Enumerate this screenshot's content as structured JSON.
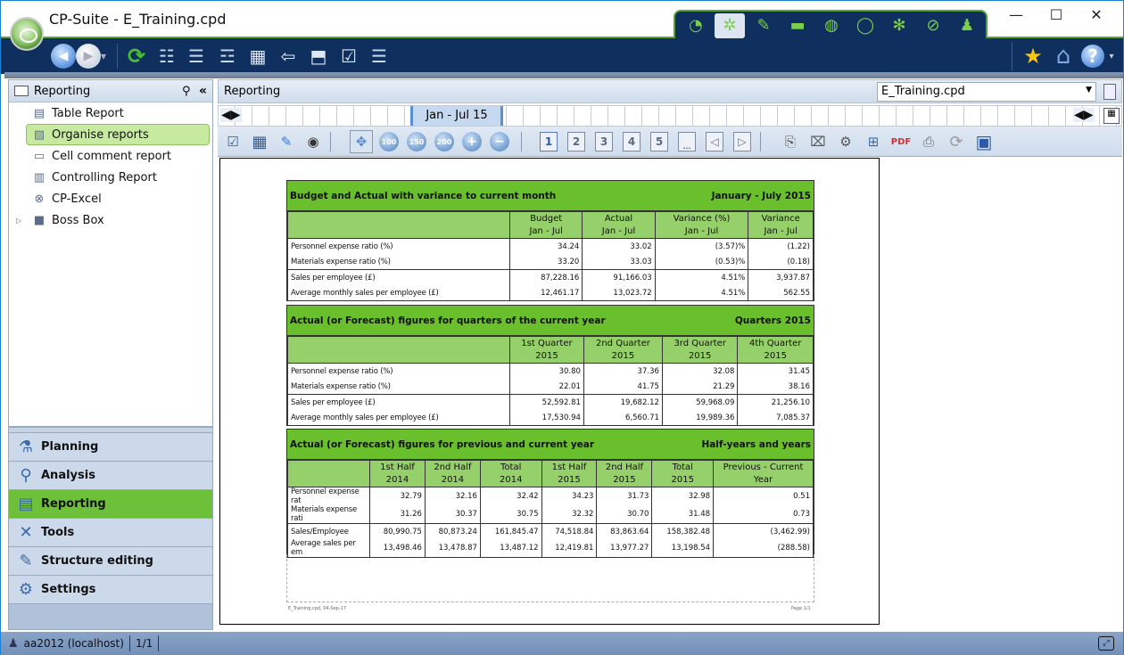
{
  "window": {
    "title": "CP-Suite - E_Training.cpd",
    "controls": {
      "minimize": "—",
      "maximize": "☐",
      "close": "✕"
    }
  },
  "module_tabs": [
    {
      "icon": "speedometer-icon",
      "glyph": "◔",
      "active": false
    },
    {
      "icon": "planning-gears-icon",
      "glyph": "✲",
      "active": true
    },
    {
      "icon": "feather-icon",
      "glyph": "✎",
      "active": false
    },
    {
      "icon": "money-icon",
      "glyph": "▬",
      "active": false
    },
    {
      "icon": "globe-icon",
      "glyph": "◍",
      "active": false
    },
    {
      "icon": "lifebuoy-icon",
      "glyph": "◯",
      "active": false
    },
    {
      "icon": "gears-icon",
      "glyph": "✻",
      "active": false
    },
    {
      "icon": "compass-icon",
      "glyph": "⊘",
      "active": false
    },
    {
      "icon": "users-report-icon",
      "glyph": "♟",
      "active": false
    }
  ],
  "toolbar": {
    "back": "◀",
    "forward": "▶",
    "history": "▾",
    "refresh": "⟳",
    "right_icons": {
      "favorites": "★",
      "home": "⌂",
      "help": "?"
    }
  },
  "left_panel": {
    "title": "Reporting",
    "search_glyph": "⚲",
    "collapse_glyph": "«",
    "items": [
      {
        "label": "Table Report",
        "glyph": "▤",
        "selected": false
      },
      {
        "label": "Organise reports",
        "glyph": "▧",
        "selected": true
      },
      {
        "label": "Cell comment report",
        "glyph": "▭",
        "selected": false
      },
      {
        "label": "Controlling Report",
        "glyph": "▥",
        "selected": false
      },
      {
        "label": "CP-Excel",
        "glyph": "⊗",
        "selected": false
      },
      {
        "label": "Boss Box",
        "glyph": "■",
        "selected": false,
        "expandable": true
      }
    ]
  },
  "nav": [
    {
      "label": "Planning",
      "glyph": "⚗",
      "selected": false
    },
    {
      "label": "Analysis",
      "glyph": "⚲",
      "selected": false
    },
    {
      "label": "Reporting",
      "glyph": "▤",
      "selected": true
    },
    {
      "label": "Tools",
      "glyph": "✕",
      "selected": false
    },
    {
      "label": "Structure editing",
      "glyph": "✎",
      "selected": false
    },
    {
      "label": "Settings",
      "glyph": "⚙",
      "selected": false
    }
  ],
  "main": {
    "header": "Reporting",
    "file_select": "E_Training.cpd",
    "timeline_period": "Jan - Jul 15",
    "zoom_labels": [
      "100",
      "150",
      "200"
    ],
    "pages": [
      "1",
      "2",
      "3",
      "4",
      "5",
      "..."
    ]
  },
  "report": {
    "sections": [
      {
        "title": "Budget and Actual with variance to current month",
        "period": "January - July 2015",
        "columns": [
          [
            "Budget",
            "Jan - Jul"
          ],
          [
            "Actual",
            "Jan - Jul"
          ],
          [
            "Variance (%)",
            "Jan - Jul"
          ],
          [
            "Variance",
            "Jan - Jul"
          ]
        ],
        "rows": [
          {
            "label": "Personnel expense ratio (%)",
            "values": [
              "34.24",
              "33.02",
              "(3.57)%",
              "(1.22)"
            ]
          },
          {
            "label": "Materials expense ratio (%)",
            "values": [
              "33.20",
              "33.03",
              "(0.53)%",
              "(0.18)"
            ]
          },
          {
            "label": "Sales per employee (£)",
            "values": [
              "87,228.16",
              "91,166.03",
              "4.51%",
              "3,937.87"
            ]
          },
          {
            "label": "Average monthly sales per employee (£)",
            "values": [
              "12,461.17",
              "13,023.72",
              "4.51%",
              "562.55"
            ]
          }
        ]
      },
      {
        "title": "Actual (or Forecast) figures for quarters of the current year",
        "period": "Quarters 2015",
        "columns": [
          [
            "1st Quarter",
            "2015"
          ],
          [
            "2nd Quarter",
            "2015"
          ],
          [
            "3rd Quarter",
            "2015"
          ],
          [
            "4th Quarter",
            "2015"
          ]
        ],
        "rows": [
          {
            "label": "Personnel expense ratio (%)",
            "values": [
              "30.80",
              "37.36",
              "32.08",
              "31.45"
            ]
          },
          {
            "label": "Materials expense ratio (%)",
            "values": [
              "22.01",
              "41.75",
              "21.29",
              "38.16"
            ]
          },
          {
            "label": "Sales per employee (£)",
            "values": [
              "52,592.81",
              "19,682.12",
              "59,968.09",
              "21,256.10"
            ]
          },
          {
            "label": "Average monthly sales per employee (£)",
            "values": [
              "17,530.94",
              "6,560.71",
              "19,989.36",
              "7,085.37"
            ]
          }
        ]
      },
      {
        "title": "Actual (or Forecast) figures for previous and current year",
        "period": "Half-years and years",
        "columns": [
          [
            "1st Half",
            "2014"
          ],
          [
            "2nd Half",
            "2014"
          ],
          [
            "Total",
            "2014"
          ],
          [
            "1st Half",
            "2015"
          ],
          [
            "2nd Half",
            "2015"
          ],
          [
            "Total",
            "2015"
          ],
          [
            "Previous - Current",
            "Year"
          ]
        ],
        "rows": [
          {
            "label": "Personnel expense rat",
            "values": [
              "32.79",
              "32.16",
              "32.42",
              "34.23",
              "31.73",
              "32.98",
              "0.51"
            ]
          },
          {
            "label": "Materials expense rati",
            "values": [
              "31.26",
              "30.37",
              "30.75",
              "32.32",
              "30.70",
              "31.48",
              "0.73"
            ]
          },
          {
            "label": "Sales/Employee",
            "values": [
              "80,990.75",
              "80,873.24",
              "161,845.47",
              "74,518.84",
              "83,863.64",
              "158,382.48",
              "(3,462.99)"
            ]
          },
          {
            "label": "Average sales per em",
            "values": [
              "13,498.46",
              "13,478.87",
              "13,487.12",
              "12,419.81",
              "13,977.27",
              "13,198.54",
              "(288.58)"
            ]
          }
        ]
      }
    ],
    "footer_left": "E_Training.cpd, 04-Sep-17",
    "footer_right": "Page 1/1"
  },
  "status": {
    "user": "aa2012 (localhost)",
    "page": "1/1"
  }
}
